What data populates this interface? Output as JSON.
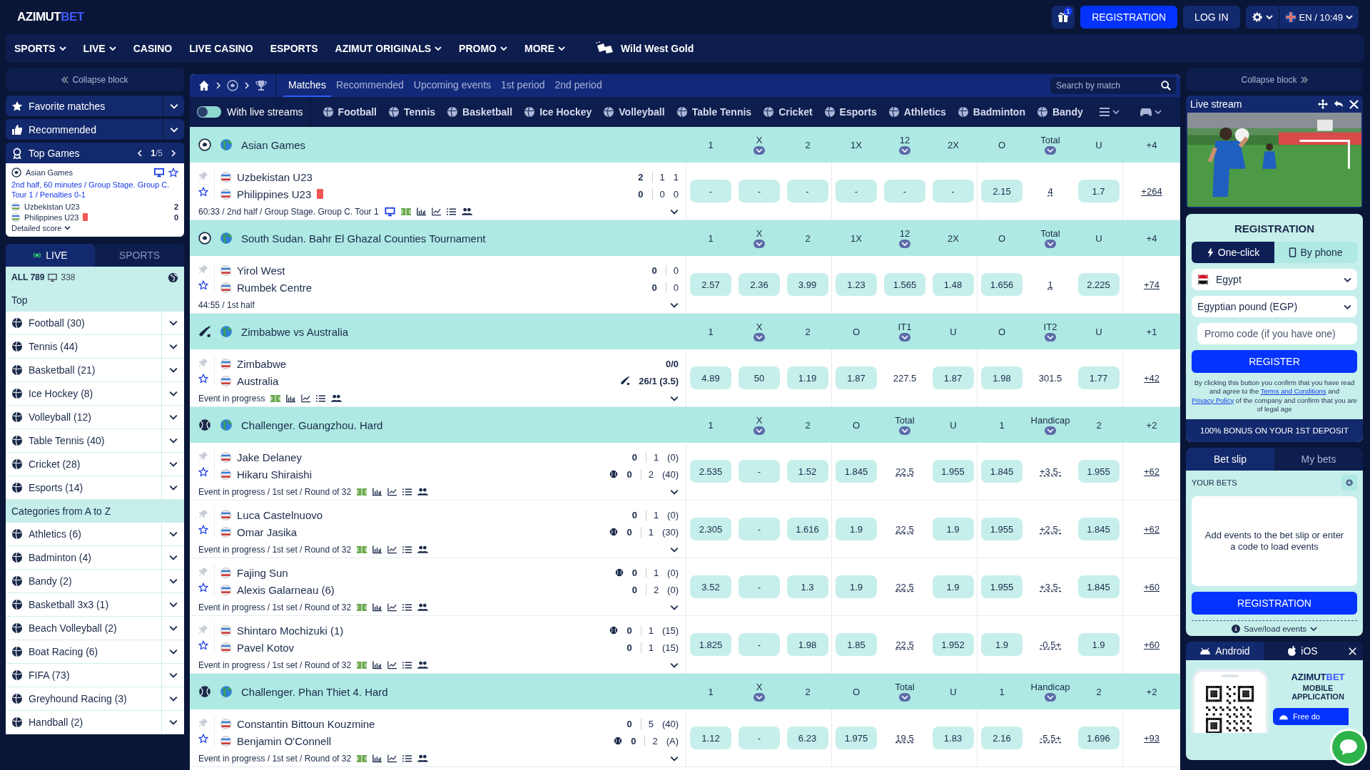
{
  "header": {
    "logo": {
      "main": "AZIMUT",
      "accent": "BET"
    },
    "gift_badge": "1",
    "register": "REGISTRATION",
    "login": "LOG IN",
    "locale": "EN / 10:49"
  },
  "nav": [
    {
      "label": "SPORTS",
      "menu": true
    },
    {
      "label": "LIVE",
      "menu": true
    },
    {
      "label": "CASINO",
      "menu": false
    },
    {
      "label": "LIVE CASINO",
      "menu": false
    },
    {
      "label": "ESPORTS",
      "menu": false
    },
    {
      "label": "AZIMUT ORIGINALS",
      "menu": true
    },
    {
      "label": "PROMO",
      "menu": true
    },
    {
      "label": "MORE",
      "menu": true
    }
  ],
  "nav_promo": "Wild West Gold",
  "left": {
    "collapse": "Collapse block",
    "sections": [
      {
        "label": "Favorite matches"
      },
      {
        "label": "Recommended"
      }
    ],
    "top_games": {
      "title": "Top Games",
      "page": "**1**/5",
      "card": {
        "league": "Asian Games",
        "info": "2nd half, 60 minutes / Group Stage. Group C. Tour 1 / Penalties 0-1",
        "teams": [
          {
            "name": "Uzbekistan U23",
            "score": "2",
            "red_card": false
          },
          {
            "name": "Philippines U23",
            "score": "0",
            "red_card": true
          }
        ],
        "details": "Detailed score"
      }
    },
    "tabs": [
      {
        "label": "LIVE",
        "selected": true
      },
      {
        "label": "SPORTS",
        "selected": false
      }
    ],
    "all": "ALL 789",
    "streams": "338",
    "top_heading": "Top",
    "top": [
      "Football (30)",
      "Tennis (44)",
      "Basketball (21)",
      "Ice Hockey (8)",
      "Volleyball (12)",
      "Table Tennis (40)",
      "Cricket (28)",
      "Esports (14)"
    ],
    "az_heading": "Categories from A to Z",
    "az": [
      "Athletics (6)",
      "Badminton (4)",
      "Bandy (2)",
      "Basketball 3x3 (1)",
      "Beach Volleyball (2)",
      "Boat Racing (6)",
      "FIFA (73)",
      "Greyhound Racing (3)",
      "Handball (2)"
    ]
  },
  "center": {
    "tabs": [
      {
        "label": "Matches",
        "selected": true
      },
      {
        "label": "Recommended",
        "selected": false
      },
      {
        "label": "Upcoming events",
        "selected": false
      },
      {
        "label": "1st period",
        "selected": false
      },
      {
        "label": "2nd period",
        "selected": false
      }
    ],
    "search_placeholder": "Search by match",
    "live_streams": {
      "label": "With live streams",
      "on": false
    },
    "sports": [
      "Football",
      "Tennis",
      "Basketball",
      "Ice Hockey",
      "Volleyball",
      "Table Tennis",
      "Cricket",
      "Esports",
      "Athletics",
      "Badminton",
      "Bandy"
    ],
    "groups": [
      {
        "kind": "football",
        "title": "Asian Games",
        "more": "+4",
        "columns": [
          {
            "label": "1",
            "menu": false
          },
          {
            "label": "X",
            "menu": true
          },
          {
            "label": "2",
            "menu": false
          },
          {
            "label": "1X",
            "menu": false
          },
          {
            "label": "12",
            "menu": true
          },
          {
            "label": "2X",
            "menu": false
          },
          {
            "label": "O",
            "menu": false
          },
          {
            "label": "Total",
            "menu": true
          },
          {
            "label": "U",
            "menu": false
          }
        ],
        "matches": [
          {
            "teams": [
              {
                "name": "Uzbekistan U23",
                "red_card": false,
                "serving": false,
                "scores": [
                  "2",
                  "1",
                  "1"
                ]
              },
              {
                "name": "Philippines U23",
                "red_card": true,
                "serving": false,
                "scores": [
                  "0",
                  "0",
                  "0"
                ]
              }
            ],
            "info": "60:33 / 2nd half / Group Stage. Group C. Tour 1",
            "live_stream": true,
            "stats": true,
            "odds": [
              {
                "value": "-",
                "kind": "button"
              },
              {
                "value": "-",
                "kind": "button"
              },
              {
                "value": "-",
                "kind": "button"
              },
              {
                "value": "-",
                "kind": "button"
              },
              {
                "value": "-",
                "kind": "button"
              },
              {
                "value": "-",
                "kind": "button"
              },
              {
                "value": "2.15",
                "kind": "button"
              },
              {
                "value": "4",
                "kind": "line"
              },
              {
                "value": "1.7",
                "kind": "button"
              }
            ],
            "more": "+264"
          }
        ]
      },
      {
        "kind": "football",
        "title": "South Sudan. Bahr El Ghazal Counties Tournament",
        "more": "+4",
        "columns": [
          {
            "label": "1",
            "menu": false
          },
          {
            "label": "X",
            "menu": true
          },
          {
            "label": "2",
            "menu": false
          },
          {
            "label": "1X",
            "menu": false
          },
          {
            "label": "12",
            "menu": true
          },
          {
            "label": "2X",
            "menu": false
          },
          {
            "label": "O",
            "menu": false
          },
          {
            "label": "Total",
            "menu": true
          },
          {
            "label": "U",
            "menu": false
          }
        ],
        "matches": [
          {
            "teams": [
              {
                "name": "Yirol West",
                "red_card": false,
                "serving": false,
                "scores": [
                  "0",
                  "0"
                ]
              },
              {
                "name": "Rumbek Centre",
                "red_card": false,
                "serving": false,
                "scores": [
                  "0",
                  "0"
                ]
              }
            ],
            "info": "44:55 / 1st half",
            "live_stream": false,
            "stats": false,
            "odds": [
              {
                "value": "2.57",
                "kind": "button"
              },
              {
                "value": "2.36",
                "kind": "button"
              },
              {
                "value": "3.99",
                "kind": "button"
              },
              {
                "value": "1.23",
                "kind": "button"
              },
              {
                "value": "1.565",
                "kind": "button"
              },
              {
                "value": "1.48",
                "kind": "button"
              },
              {
                "value": "1.656",
                "kind": "button"
              },
              {
                "value": "1",
                "kind": "line"
              },
              {
                "value": "2.225",
                "kind": "button"
              }
            ],
            "more": "+74"
          }
        ]
      },
      {
        "kind": "cricket",
        "title": "Zimbabwe vs Australia",
        "more": "+1",
        "columns": [
          {
            "label": "1",
            "menu": false
          },
          {
            "label": "X",
            "menu": true
          },
          {
            "label": "2",
            "menu": false
          },
          {
            "label": "O",
            "menu": false
          },
          {
            "label": "IT1",
            "menu": true
          },
          {
            "label": "U",
            "menu": false
          },
          {
            "label": "O",
            "menu": false
          },
          {
            "label": "IT2",
            "menu": true
          },
          {
            "label": "U",
            "menu": false
          }
        ],
        "matches": [
          {
            "teams": [
              {
                "name": "Zimbabwe",
                "red_card": false,
                "serving": false,
                "scores": [
                  "0/0"
                ]
              },
              {
                "name": "Australia",
                "red_card": false,
                "serving": true,
                "scores": [
                  "26/1 (3.5)"
                ]
              }
            ],
            "info": "Event in progress",
            "live_stream": false,
            "stats": true,
            "odds": [
              {
                "value": "4.89",
                "kind": "button"
              },
              {
                "value": "50",
                "kind": "button"
              },
              {
                "value": "1.19",
                "kind": "button"
              },
              {
                "value": "1.87",
                "kind": "button"
              },
              {
                "value": "227.5",
                "kind": "plain"
              },
              {
                "value": "1.87",
                "kind": "button"
              },
              {
                "value": "1.98",
                "kind": "button"
              },
              {
                "value": "301.5",
                "kind": "plain"
              },
              {
                "value": "1.77",
                "kind": "button"
              }
            ],
            "more": "+42"
          }
        ]
      },
      {
        "kind": "tennis",
        "title": "Challenger. Guangzhou. Hard",
        "more": "+2",
        "columns": [
          {
            "label": "1",
            "menu": false
          },
          {
            "label": "X",
            "menu": true
          },
          {
            "label": "2",
            "menu": false
          },
          {
            "label": "O",
            "menu": false
          },
          {
            "label": "Total",
            "menu": true
          },
          {
            "label": "U",
            "menu": false
          },
          {
            "label": "1",
            "menu": false
          },
          {
            "label": "Handicap",
            "menu": true
          },
          {
            "label": "2",
            "menu": false
          }
        ],
        "matches": [
          {
            "teams": [
              {
                "name": "Jake Delaney",
                "red_card": false,
                "serving": false,
                "scores": [
                  "0",
                  "1",
                  "(0)"
                ]
              },
              {
                "name": "Hikaru Shiraishi",
                "red_card": false,
                "serving": true,
                "scores": [
                  "0",
                  "2",
                  "(40)"
                ]
              }
            ],
            "info": "Event in progress / 1st set / Round of 32",
            "live_stream": false,
            "stats": true,
            "odds": [
              {
                "value": "2.535",
                "kind": "button"
              },
              {
                "value": "-",
                "kind": "button"
              },
              {
                "value": "1.52",
                "kind": "button"
              },
              {
                "value": "1.845",
                "kind": "button"
              },
              {
                "value": "22.5",
                "kind": "line"
              },
              {
                "value": "1.955",
                "kind": "button"
              },
              {
                "value": "1.845",
                "kind": "button"
              },
              {
                "value": "+3.5-",
                "kind": "line"
              },
              {
                "value": "1.955",
                "kind": "button"
              }
            ],
            "more": "+62"
          },
          {
            "teams": [
              {
                "name": "Luca Castelnuovo",
                "red_card": false,
                "serving": false,
                "scores": [
                  "0",
                  "1",
                  "(0)"
                ]
              },
              {
                "name": "Omar Jasika",
                "red_card": false,
                "serving": true,
                "scores": [
                  "0",
                  "1",
                  "(30)"
                ]
              }
            ],
            "info": "Event in progress / 1st set / Round of 32",
            "live_stream": false,
            "stats": true,
            "odds": [
              {
                "value": "2.305",
                "kind": "button"
              },
              {
                "value": "-",
                "kind": "button"
              },
              {
                "value": "1.616",
                "kind": "button"
              },
              {
                "value": "1.9",
                "kind": "button"
              },
              {
                "value": "22.5",
                "kind": "line"
              },
              {
                "value": "1.9",
                "kind": "button"
              },
              {
                "value": "1.955",
                "kind": "button"
              },
              {
                "value": "+2.5-",
                "kind": "line"
              },
              {
                "value": "1.845",
                "kind": "button"
              }
            ],
            "more": "+62"
          },
          {
            "teams": [
              {
                "name": "Fajing Sun",
                "red_card": false,
                "serving": true,
                "scores": [
                  "0",
                  "1",
                  "(0)"
                ]
              },
              {
                "name": "Alexis Galarneau (6)",
                "red_card": false,
                "serving": false,
                "scores": [
                  "0",
                  "2",
                  "(0)"
                ]
              }
            ],
            "info": "Event in progress / 1st set / Round of 32",
            "live_stream": false,
            "stats": true,
            "odds": [
              {
                "value": "3.52",
                "kind": "button"
              },
              {
                "value": "-",
                "kind": "button"
              },
              {
                "value": "1.3",
                "kind": "button"
              },
              {
                "value": "1.9",
                "kind": "button"
              },
              {
                "value": "22.5",
                "kind": "line"
              },
              {
                "value": "1.9",
                "kind": "button"
              },
              {
                "value": "1.955",
                "kind": "button"
              },
              {
                "value": "+3.5-",
                "kind": "line"
              },
              {
                "value": "1.845",
                "kind": "button"
              }
            ],
            "more": "+60"
          },
          {
            "teams": [
              {
                "name": "Shintaro Mochizuki (1)",
                "red_card": false,
                "serving": true,
                "scores": [
                  "0",
                  "1",
                  "(15)"
                ]
              },
              {
                "name": "Pavel Kotov",
                "red_card": false,
                "serving": false,
                "scores": [
                  "0",
                  "1",
                  "(15)"
                ]
              }
            ],
            "info": "Event in progress / 1st set / Round of 32",
            "live_stream": false,
            "stats": true,
            "odds": [
              {
                "value": "1.825",
                "kind": "button"
              },
              {
                "value": "-",
                "kind": "button"
              },
              {
                "value": "1.98",
                "kind": "button"
              },
              {
                "value": "1.85",
                "kind": "button"
              },
              {
                "value": "22.5",
                "kind": "line"
              },
              {
                "value": "1.952",
                "kind": "button"
              },
              {
                "value": "1.9",
                "kind": "button"
              },
              {
                "value": "-0.5+",
                "kind": "line"
              },
              {
                "value": "1.9",
                "kind": "button"
              }
            ],
            "more": "+60"
          }
        ]
      },
      {
        "kind": "tennis",
        "title": "Challenger. Phan Thiet 4. Hard",
        "more": "+2",
        "columns": [
          {
            "label": "1",
            "menu": false
          },
          {
            "label": "X",
            "menu": true
          },
          {
            "label": "2",
            "menu": false
          },
          {
            "label": "O",
            "menu": false
          },
          {
            "label": "Total",
            "menu": true
          },
          {
            "label": "U",
            "menu": false
          },
          {
            "label": "1",
            "menu": false
          },
          {
            "label": "Handicap",
            "menu": true
          },
          {
            "label": "2",
            "menu": false
          }
        ],
        "matches": [
          {
            "teams": [
              {
                "name": "Constantin Bittoun Kouzmine",
                "red_card": false,
                "serving": false,
                "scores": [
                  "0",
                  "5",
                  "(40)"
                ]
              },
              {
                "name": "Benjamin O'Connell",
                "red_card": false,
                "serving": true,
                "scores": [
                  "0",
                  "2",
                  "(A)"
                ]
              }
            ],
            "info": "Event in progress / 1st set / Round of 32",
            "live_stream": false,
            "stats": true,
            "odds": [
              {
                "value": "1.12",
                "kind": "button"
              },
              {
                "value": "-",
                "kind": "button"
              },
              {
                "value": "6.23",
                "kind": "button"
              },
              {
                "value": "1.975",
                "kind": "button"
              },
              {
                "value": "19.5",
                "kind": "line"
              },
              {
                "value": "1.83",
                "kind": "button"
              },
              {
                "value": "2.16",
                "kind": "button"
              },
              {
                "value": "-5.5+",
                "kind": "line"
              },
              {
                "value": "1.696",
                "kind": "button"
              }
            ],
            "more": "+93"
          }
        ]
      }
    ]
  },
  "right": {
    "collapse": "Collapse block",
    "stream_title": "Live stream",
    "registration": {
      "title": "REGISTRATION",
      "methods": [
        {
          "label": "One-click",
          "selected": true
        },
        {
          "label": "By phone",
          "selected": false
        }
      ],
      "country": "Egypt",
      "currency": "Egyptian pound (EGP)",
      "promo_placeholder": "Promo code (if you have one)",
      "submit": "REGISTER",
      "legal": {
        "before": "By clicking this button you confirm that you have read and agree to the",
        "link_1": "Terms and Conditions",
        "middle": "and",
        "link_2": "Privacy Policy",
        "after": "of the company and confirm that you are of legal age"
      },
      "bonus": "100% BONUS ON YOUR 1ST DEPOSIT"
    },
    "betslip": {
      "tabs": [
        {
          "label": "Bet slip",
          "selected": true
        },
        {
          "label": "My bets",
          "selected": false
        }
      ],
      "your_bets": "YOUR BETS",
      "empty": "Add events to the bet slip or enter a code to load events",
      "button": "REGISTRATION",
      "save": "Save/load events"
    },
    "app": {
      "tabs": [
        {
          "label": "Android",
          "selected": true
        },
        {
          "label": "iOS",
          "selected": false
        }
      ],
      "logo": {
        "main": "AZIMUT",
        "accent": "BET"
      },
      "subtitle": "MOBILE APPLICATION",
      "download": "Free do"
    }
  }
}
